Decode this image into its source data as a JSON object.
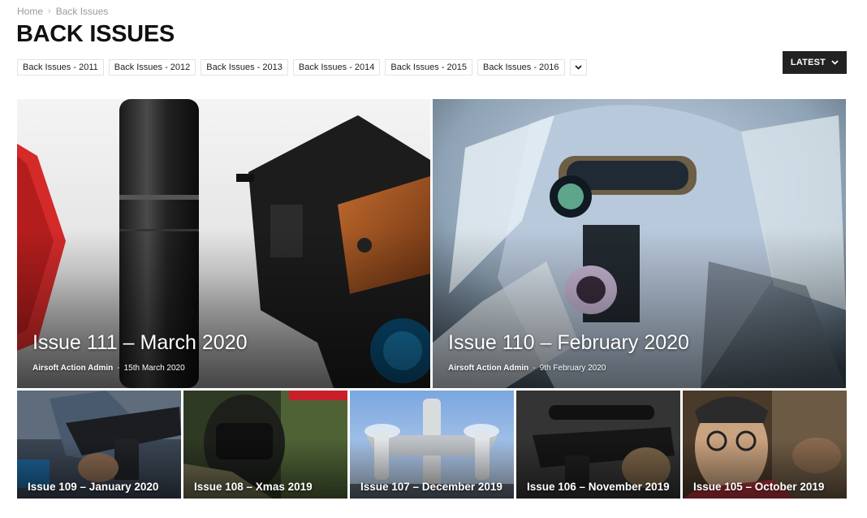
{
  "breadcrumb": {
    "home": "Home",
    "separator": "›",
    "current": "Back Issues"
  },
  "page": {
    "title": "BACK ISSUES"
  },
  "filters": [
    "Back Issues - 2011",
    "Back Issues - 2012",
    "Back Issues - 2013",
    "Back Issues - 2014",
    "Back Issues - 2015",
    "Back Issues - 2016"
  ],
  "sort": {
    "label": "LATEST",
    "icon": "chevron-down-icon"
  },
  "featured": [
    {
      "title": "Issue 111 – March 2020",
      "author": "Airsoft Action Admin",
      "separator": "-",
      "date": "15th March 2020"
    },
    {
      "title": "Issue 110 – February 2020",
      "author": "Airsoft Action Admin",
      "separator": "-",
      "date": "9th February 2020"
    }
  ],
  "issues": [
    {
      "title": "Issue 109 – January 2020"
    },
    {
      "title": "Issue 108 – Xmas 2019"
    },
    {
      "title": "Issue 107 – December 2019"
    },
    {
      "title": "Issue 106 – November 2019"
    },
    {
      "title": "Issue 105 – October 2019"
    }
  ],
  "colors": {
    "button_bg": "#222222",
    "pill_border": "#e3e3e3",
    "breadcrumb": "#9a9a9a"
  }
}
